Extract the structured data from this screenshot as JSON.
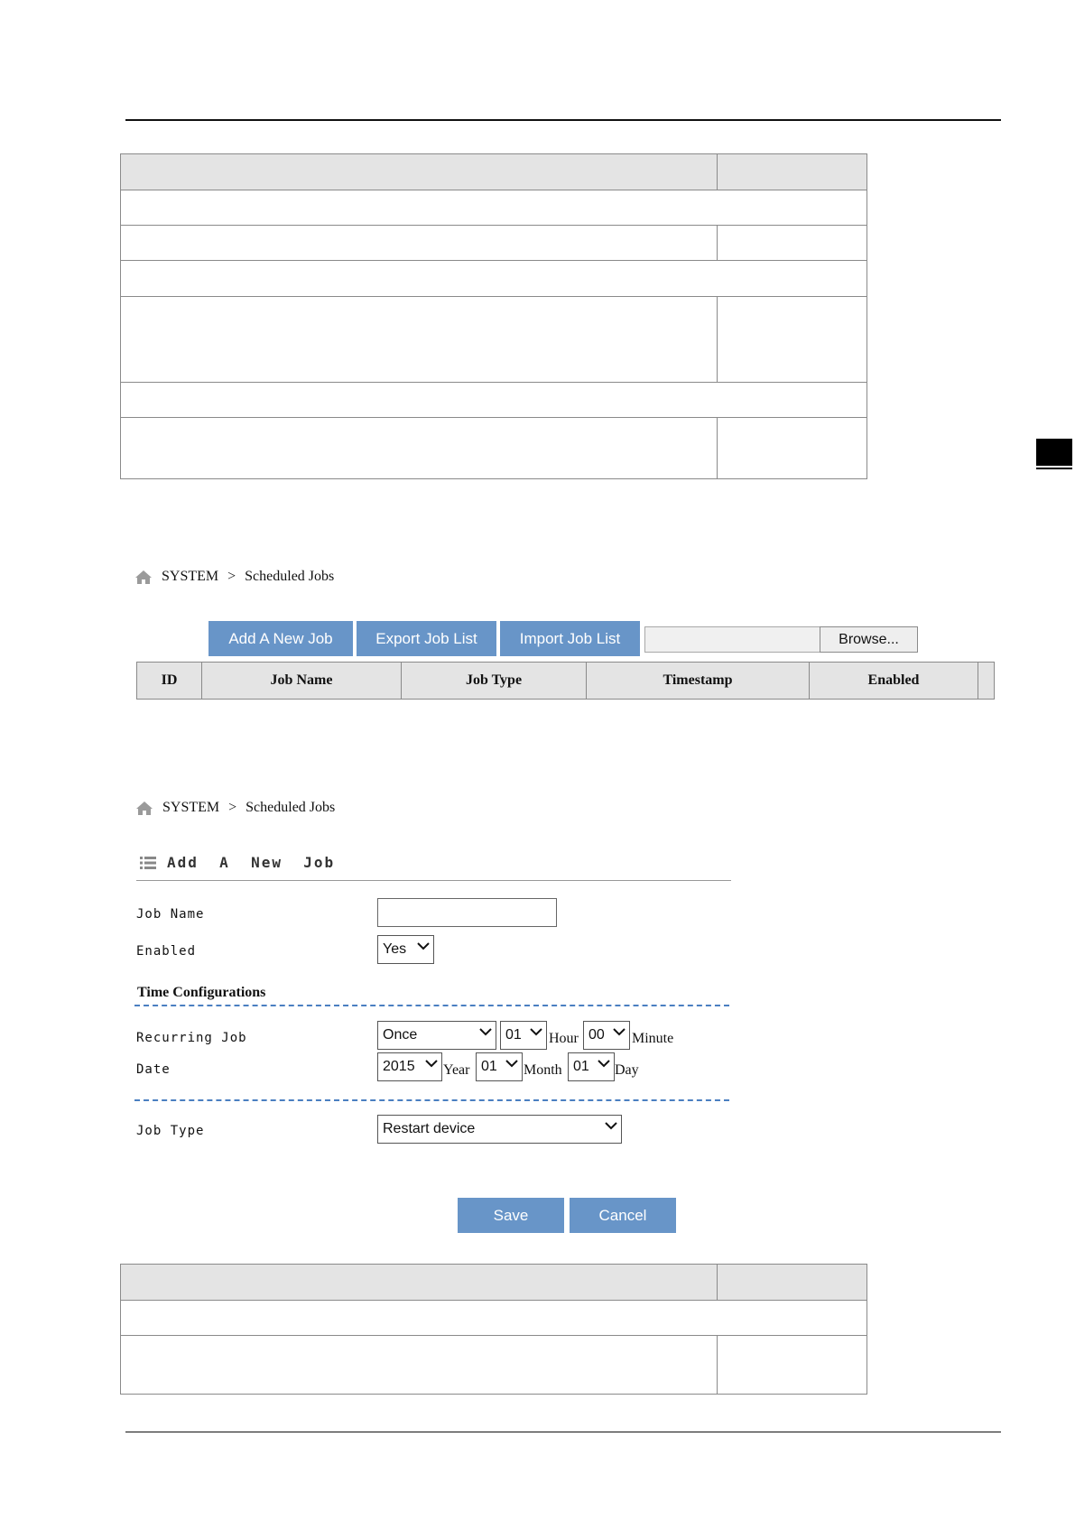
{
  "breadcrumb": {
    "root": "SYSTEM",
    "separator": ">",
    "page": "Scheduled Jobs",
    "icon": "home-icon"
  },
  "job_list": {
    "buttons": {
      "add": "Add A New Job",
      "export": "Export Job List",
      "import": "Import Job List",
      "browse": "Browse..."
    },
    "columns": [
      "ID",
      "Job Name",
      "Job Type",
      "Timestamp",
      "Enabled"
    ]
  },
  "add_job": {
    "title": "Add  A  New  Job",
    "job_name_label": "Job Name",
    "job_name_value": "",
    "enabled_label": "Enabled",
    "enabled_value": "Yes",
    "time_config_title": "Time Configurations",
    "recurring_label": "Recurring Job",
    "recurring_value": "Once",
    "hour_value": "01",
    "hour_unit": "Hour",
    "minute_value": "00",
    "minute_unit": "Minute",
    "date_label": "Date",
    "year_value": "2015",
    "year_unit": "Year",
    "month_value": "01",
    "month_unit": "Month",
    "day_value": "01",
    "day_unit": "Day",
    "job_type_label": "Job Type",
    "job_type_value": "Restart device",
    "save": "Save",
    "cancel": "Cancel"
  },
  "colors": {
    "button_blue": "#6895c8",
    "dashed_line": "#4a7fc1",
    "header_gray": "#e4e4e4"
  }
}
